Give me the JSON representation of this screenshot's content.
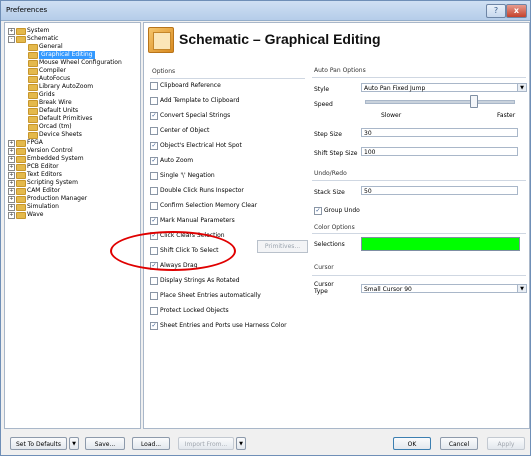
{
  "window": {
    "title": "Preferences",
    "help_icon": "?",
    "close_icon": "x"
  },
  "tree": {
    "items": [
      {
        "label": "System",
        "level": 0,
        "expander": "+"
      },
      {
        "label": "Schematic",
        "level": 0,
        "expander": "-"
      },
      {
        "label": "General",
        "level": 1
      },
      {
        "label": "Graphical Editing",
        "level": 1,
        "selected": true
      },
      {
        "label": "Mouse Wheel Configuration",
        "level": 1
      },
      {
        "label": "Compiler",
        "level": 1
      },
      {
        "label": "AutoFocus",
        "level": 1
      },
      {
        "label": "Library AutoZoom",
        "level": 1
      },
      {
        "label": "Grids",
        "level": 1
      },
      {
        "label": "Break Wire",
        "level": 1
      },
      {
        "label": "Default Units",
        "level": 1
      },
      {
        "label": "Default Primitives",
        "level": 1
      },
      {
        "label": "Orcad (tm)",
        "level": 1
      },
      {
        "label": "Device Sheets",
        "level": 1
      },
      {
        "label": "FPGA",
        "level": 0,
        "expander": "+"
      },
      {
        "label": "Version Control",
        "level": 0,
        "expander": "+"
      },
      {
        "label": "Embedded System",
        "level": 0,
        "expander": "+"
      },
      {
        "label": "PCB Editor",
        "level": 0,
        "expander": "+"
      },
      {
        "label": "Text Editors",
        "level": 0,
        "expander": "+"
      },
      {
        "label": "Scripting System",
        "level": 0,
        "expander": "+"
      },
      {
        "label": "CAM Editor",
        "level": 0,
        "expander": "+"
      },
      {
        "label": "Production Manager",
        "level": 0,
        "expander": "+"
      },
      {
        "label": "Simulation",
        "level": 0,
        "expander": "+"
      },
      {
        "label": "Wave",
        "level": 0,
        "expander": "+"
      }
    ]
  },
  "header": {
    "title": "Schematic – Graphical Editing"
  },
  "options": {
    "title": "Options",
    "items": [
      {
        "label": "Clipboard Reference",
        "checked": false
      },
      {
        "label": "Add Template to Clipboard",
        "checked": false
      },
      {
        "label": "Convert Special Strings",
        "checked": true
      },
      {
        "label": "Center of Object",
        "checked": false
      },
      {
        "label": "Object's Electrical Hot Spot",
        "checked": true
      },
      {
        "label": "Auto Zoom",
        "checked": true
      },
      {
        "label": "Single '\\' Negation",
        "checked": false
      },
      {
        "label": "Double Click Runs Inspector",
        "checked": false
      },
      {
        "label": "Confirm Selection Memory Clear",
        "checked": false
      },
      {
        "label": "Mark Manual Parameters",
        "checked": true
      },
      {
        "label": "Click Clears Selection",
        "checked": true
      },
      {
        "label": "Shift Click To Select",
        "checked": false
      },
      {
        "label": "Always Drag",
        "checked": true
      },
      {
        "label": "Display Strings As Rotated",
        "checked": false
      },
      {
        "label": "Place Sheet Entries automatically",
        "checked": false
      },
      {
        "label": "Protect Locked Objects",
        "checked": false
      },
      {
        "label": "Sheet Entries and Ports use Harness Color",
        "checked": true
      }
    ],
    "primitives_button": "Primitives..."
  },
  "autopan": {
    "title": "Auto Pan Options",
    "style_label": "Style",
    "style_value": "Auto Pan Fixed Jump",
    "speed_label": "Speed",
    "speed_value": 0.73,
    "slower": "Slower",
    "faster": "Faster",
    "step_size_label": "Step Size",
    "step_size_value": "30",
    "shift_step_size_label": "Shift Step Size",
    "shift_step_size_value": "100"
  },
  "undo": {
    "title": "Undo/Redo",
    "stack_size_label": "Stack Size",
    "stack_size_value": "50",
    "group_undo_label": "Group Undo",
    "group_undo_checked": true
  },
  "color": {
    "title": "Color Options",
    "selections_label": "Selections",
    "selections_color": "#00ff00"
  },
  "cursor": {
    "title": "Cursor",
    "cursor_type_label": "Cursor\nType",
    "cursor_type_value": "Small Cursor 90"
  },
  "footer": {
    "set_to_defaults": "Set To Defaults",
    "save": "Save...",
    "load": "Load...",
    "import_from": "Import From...",
    "ok": "OK",
    "cancel": "Cancel",
    "apply": "Apply"
  },
  "glyphs": {
    "check": "✓",
    "dropdown": "▼"
  },
  "annotation": {
    "ellipse_color": "#e00000"
  }
}
